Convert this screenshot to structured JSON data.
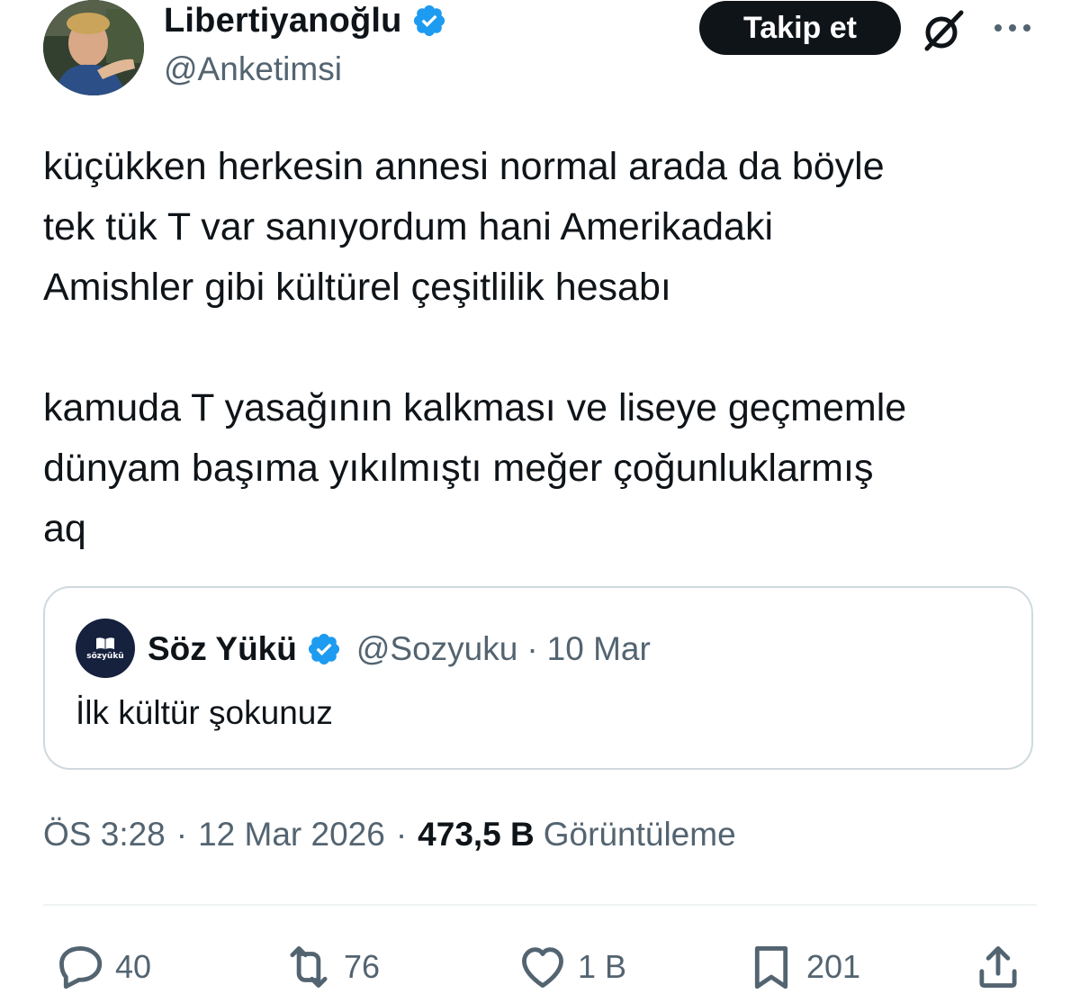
{
  "author": {
    "display_name": "Libertiyanoğlu",
    "handle": "@Anketimsi",
    "verified_icon": "verified-badge-icon",
    "verified_color": "#1d9bf0"
  },
  "header_actions": {
    "follow_label": "Takip et",
    "grok_icon": "grok-icon",
    "more_icon": "more-options-icon"
  },
  "tweet": {
    "paragraphs": [
      "küçükken herkesin annesi normal arada da böyle\ntek tük T var sanıyordum hani Amerikadaki\nAmishler gibi kültürel çeşitlilik hesabı",
      "kamuda T yasağının kalkması ve liseye geçmemle\ndünyam başıma yıkılmıştı meğer çoğunluklarmış\naq"
    ]
  },
  "quote": {
    "display_name": "Söz Yükü",
    "handle": "@Sozyuku",
    "separator": "·",
    "date": "10 Mar",
    "text": "İlk kültür şokunuz",
    "avatar_text": "sözyükü"
  },
  "meta": {
    "time": "ÖS 3:28",
    "separator": "·",
    "date": "12 Mar 2026",
    "views_count": "473,5 B",
    "views_label": "Görüntüleme"
  },
  "actions": {
    "replies": {
      "icon": "reply-icon",
      "count": "40"
    },
    "reposts": {
      "icon": "repost-icon",
      "count": "76"
    },
    "likes": {
      "icon": "like-icon",
      "count": "1 B"
    },
    "bookmarks": {
      "icon": "bookmark-icon",
      "count": "201"
    },
    "share": {
      "icon": "share-icon"
    }
  },
  "colors": {
    "text_primary": "#0f1419",
    "text_secondary": "#536471",
    "border": "#cfd9de",
    "follow_button_bg": "#0f1419"
  }
}
